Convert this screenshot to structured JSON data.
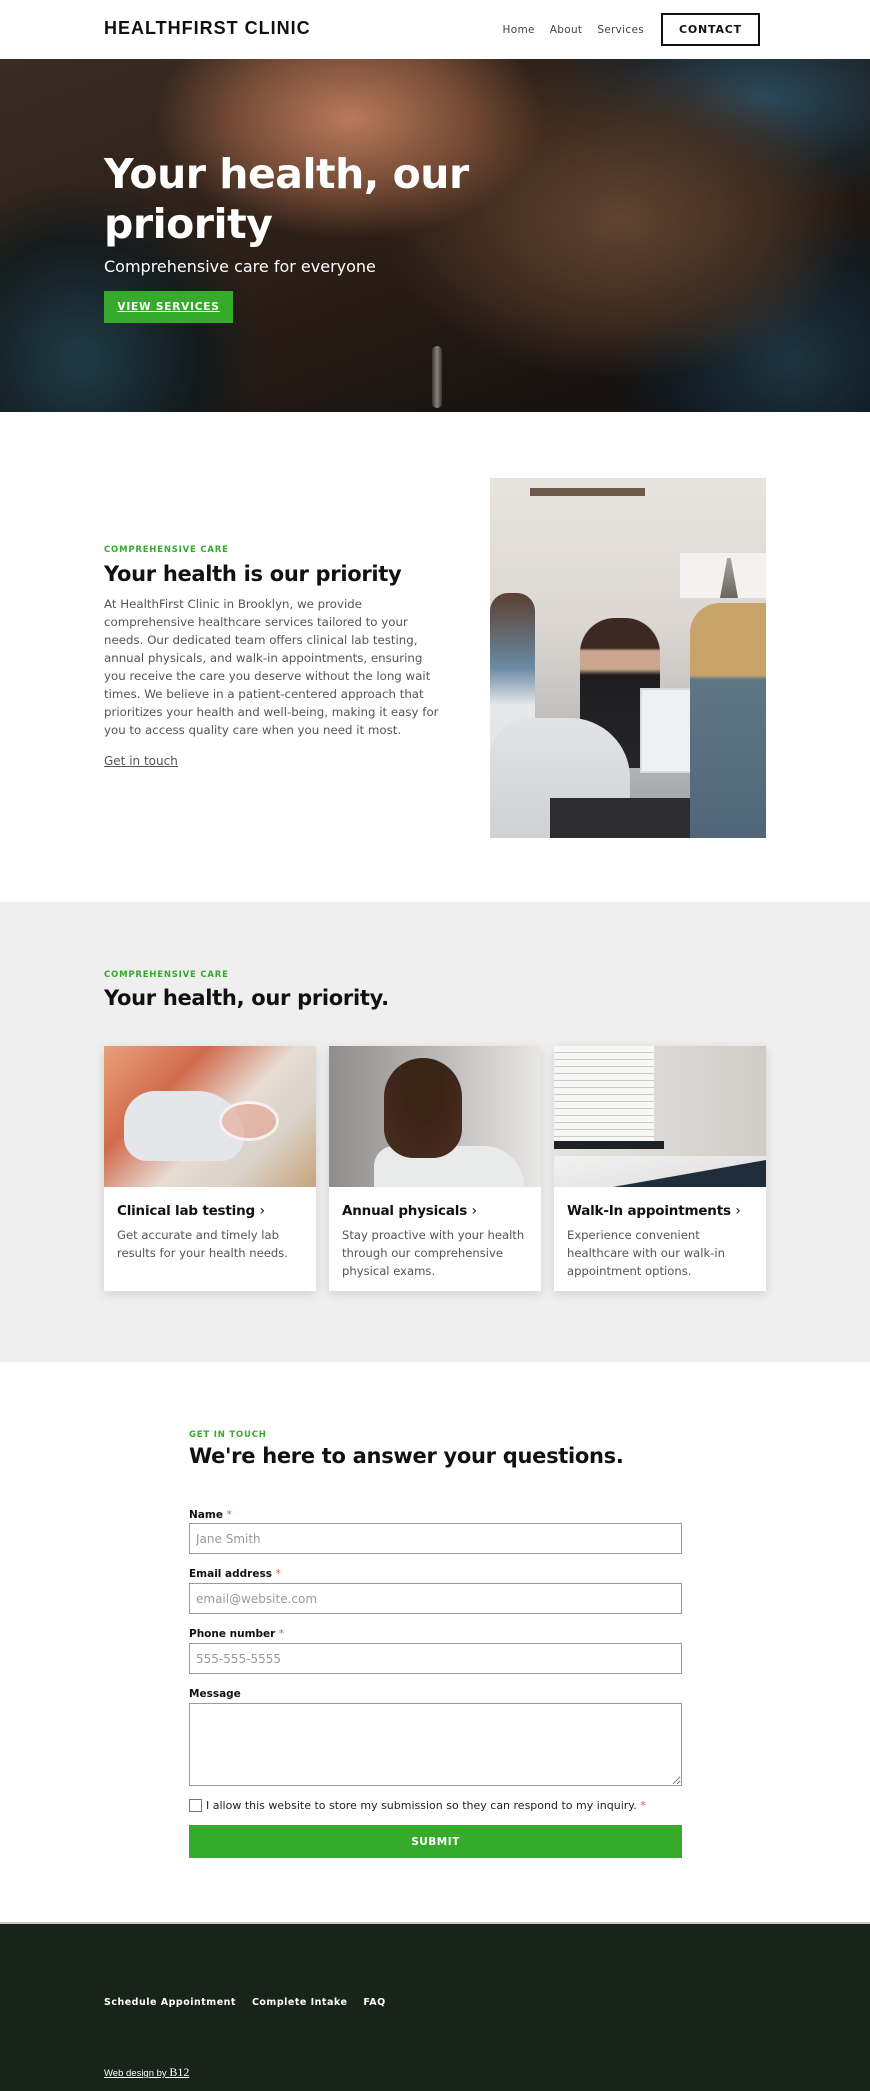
{
  "header": {
    "logo": "HEALTHFIRST CLINIC",
    "nav": [
      {
        "label": "Home"
      },
      {
        "label": "About"
      },
      {
        "label": "Services"
      }
    ],
    "contact_label": "CONTACT"
  },
  "hero": {
    "title": "Your health, our priority",
    "subtitle": "Comprehensive care for everyone",
    "button_label": "VIEW SERVICES",
    "image": "hands-holding-photo"
  },
  "about": {
    "eyebrow": "COMPREHENSIVE CARE",
    "title": "Your health is our priority",
    "body": "At HealthFirst Clinic in Brooklyn, we provide comprehensive healthcare services tailored to your needs. Our dedicated team offers clinical lab testing, annual physicals, and walk-in appointments, ensuring you receive the care you deserve without the long wait times. We believe in a patient-centered approach that prioritizes your health and well-being, making it easy for you to access quality care when you need it most.",
    "link_label": "Get in touch",
    "image": "clinic-reception-photo"
  },
  "services": {
    "eyebrow": "COMPREHENSIVE CARE",
    "title": "Your health, our priority.",
    "cards": [
      {
        "title": "Clinical lab testing",
        "chevron": "›",
        "description": "Get accurate and timely lab results for your health needs.",
        "image": "lab-petri-dish-photo"
      },
      {
        "title": "Annual physicals",
        "chevron": "›",
        "description": "Stay proactive with your health through our comprehensive physical exams.",
        "image": "doctor-stethoscope-photo"
      },
      {
        "title": "Walk-In appointments",
        "chevron": "›",
        "description": "Experience convenient healthcare with our walk-in appointment options.",
        "image": "exam-room-photo"
      }
    ]
  },
  "contact": {
    "eyebrow": "GET IN TOUCH",
    "title": "We're here to answer your questions.",
    "fields": {
      "name": {
        "label": "Name",
        "required_mark": "*",
        "placeholder": "Jane Smith",
        "value": ""
      },
      "email": {
        "label": "Email address",
        "required_mark": "*",
        "placeholder": "email@website.com",
        "value": ""
      },
      "phone": {
        "label": "Phone number",
        "required_mark": "*",
        "placeholder": "555-555-5555",
        "value": ""
      },
      "message": {
        "label": "Message",
        "value": ""
      }
    },
    "consent_text": "I allow this website to store my submission so they can respond to my inquiry.",
    "consent_required_mark": "*",
    "consent_checked": false,
    "submit_label": "SUBMIT"
  },
  "footer": {
    "links": [
      {
        "label": "Schedule Appointment"
      },
      {
        "label": "Complete Intake"
      },
      {
        "label": "FAQ"
      }
    ],
    "credit_prefix": "Web design by",
    "credit_brand": "B12"
  },
  "colors": {
    "accent_green": "#35aa2b",
    "footer_bg": "#182418",
    "section_gray": "#eeefee",
    "required_red": "#e25a3c"
  }
}
